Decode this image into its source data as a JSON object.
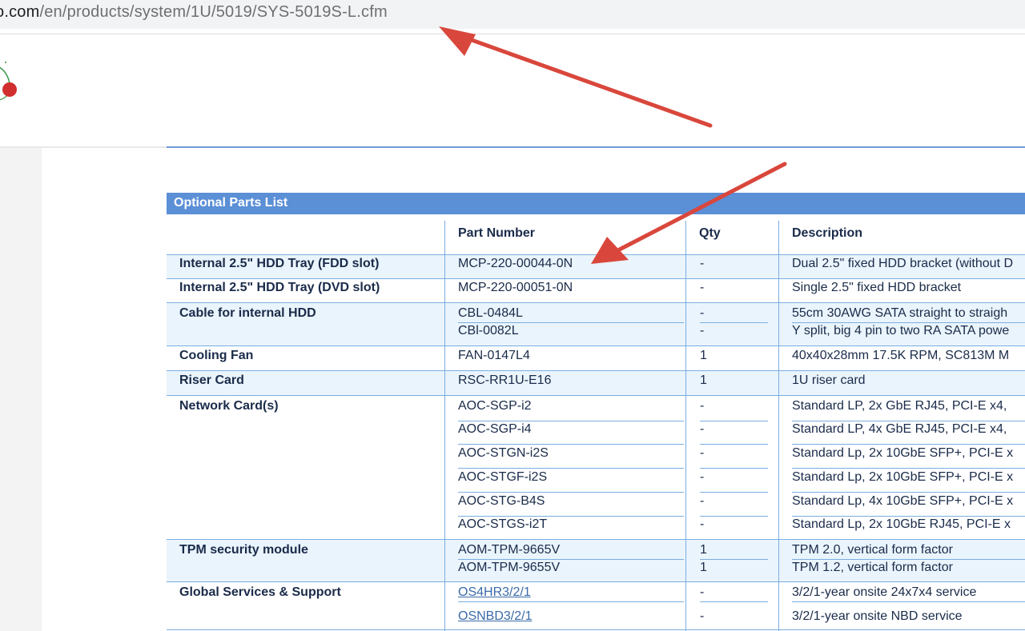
{
  "browser": {
    "url_domain": "o.com",
    "url_path": "/en/products/system/1U/5019/SYS-5019S-L.cfm"
  },
  "section": {
    "title": "Optional Parts List"
  },
  "table": {
    "headers": {
      "part_number": "Part Number",
      "qty": "Qty",
      "description": "Description"
    },
    "rows": [
      {
        "label": "Internal 2.5\" HDD Tray (FDD slot)",
        "parts": [
          {
            "pn": "MCP-220-00044-0N",
            "qty": "-",
            "desc": "Dual 2.5\" fixed HDD bracket (without D"
          }
        ]
      },
      {
        "label": "Internal 2.5\" HDD Tray (DVD slot)",
        "parts": [
          {
            "pn": "MCP-220-00051-0N",
            "qty": "-",
            "desc": "Single 2.5\" fixed HDD bracket"
          }
        ]
      },
      {
        "label": "Cable for internal HDD",
        "parts": [
          {
            "pn": "CBL-0484L",
            "qty": "-",
            "desc": "55cm 30AWG SATA straight to straigh"
          },
          {
            "pn": "CBl-0082L",
            "qty": "-",
            "desc": "Y split, big 4 pin to two RA SATA powe"
          }
        ]
      },
      {
        "label": "Cooling Fan",
        "parts": [
          {
            "pn": "FAN-0147L4",
            "qty": "1",
            "desc": "40x40x28mm 17.5K RPM, SC813M M"
          }
        ]
      },
      {
        "label": "Riser Card",
        "parts": [
          {
            "pn": "RSC-RR1U-E16",
            "qty": "1",
            "desc": "1U riser card"
          }
        ]
      },
      {
        "label": "Network Card(s)",
        "parts": [
          {
            "pn": "AOC-SGP-i2",
            "qty": "-",
            "desc": "Standard LP, 2x GbE RJ45, PCI-E x4,"
          },
          {
            "pn": "AOC-SGP-i4",
            "qty": "-",
            "desc": "Standard LP, 4x GbE RJ45, PCI-E x4,"
          },
          {
            "pn": "AOC-STGN-i2S",
            "qty": "-",
            "desc": "Standard Lp, 2x 10GbE SFP+, PCI-E x"
          },
          {
            "pn": "AOC-STGF-i2S",
            "qty": "-",
            "desc": "Standard Lp, 2x 10GbE SFP+, PCI-E x"
          },
          {
            "pn": "AOC-STG-B4S",
            "qty": "-",
            "desc": "Standard Lp, 4x 10GbE SFP+, PCI-E x"
          },
          {
            "pn": "AOC-STGS-i2T",
            "qty": "-",
            "desc": "Standard Lp, 2x 10GbE RJ45, PCI-E x"
          }
        ]
      },
      {
        "label": "TPM security module",
        "parts": [
          {
            "pn": "AOM-TPM-9665V",
            "qty": "1",
            "desc": "TPM 2.0, vertical form factor"
          },
          {
            "pn": "AOM-TPM-9655V",
            "qty": "1",
            "desc": "TPM 1.2, vertical form factor"
          }
        ]
      },
      {
        "label": "Global Services & Support",
        "parts": [
          {
            "pn": "OS4HR3/2/1",
            "qty": "-",
            "desc": "3/2/1-year onsite 24x7x4 service",
            "link": true
          },
          {
            "pn": "OSNBD3/2/1",
            "qty": "-",
            "desc": "3/2/1-year onsite NBD service",
            "link": true
          }
        ]
      }
    ]
  },
  "colors": {
    "header_bar": "#5b8fd6",
    "row_alt": "#eaf4fc",
    "arrow": "#d9473c",
    "logo_red": "#d12f2f",
    "logo_green": "#3a9a4a"
  },
  "icons": {
    "logo": "company-logo-icon",
    "arrow": "red-annotation-arrow-icon"
  }
}
